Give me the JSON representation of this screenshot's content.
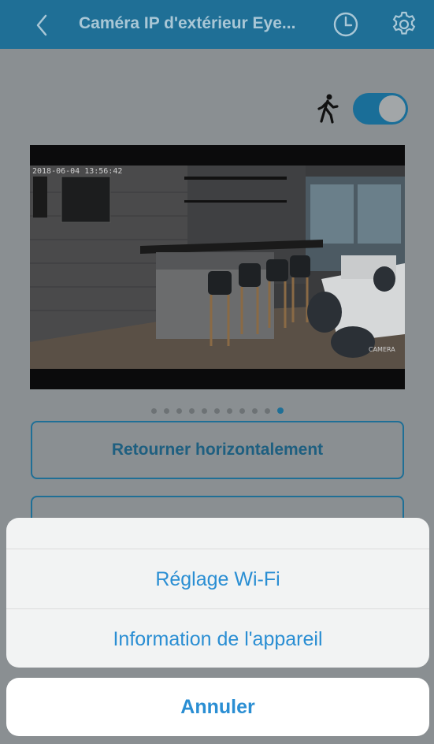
{
  "header": {
    "title": "Caméra IP d'extérieur Eye...",
    "back_icon": "chevron-left-icon",
    "history_icon": "clock-icon",
    "settings_icon": "gear-icon"
  },
  "motion_detection": {
    "icon": "walking-person-icon",
    "enabled": true
  },
  "video": {
    "timestamp": "2018-06-04 13:56:42",
    "watermark": "CAMERA"
  },
  "pager": {
    "total": 11,
    "active_index": 10
  },
  "buttons": {
    "flip_horizontal": "Retourner horizontalement"
  },
  "action_sheet": {
    "items": [
      "Réglage Wi-Fi",
      "Information de l'appareil"
    ],
    "cancel": "Annuler"
  },
  "colors": {
    "header": "#1f6f96",
    "accent": "#2a8ed3",
    "dim_background": "#8a8f92"
  }
}
